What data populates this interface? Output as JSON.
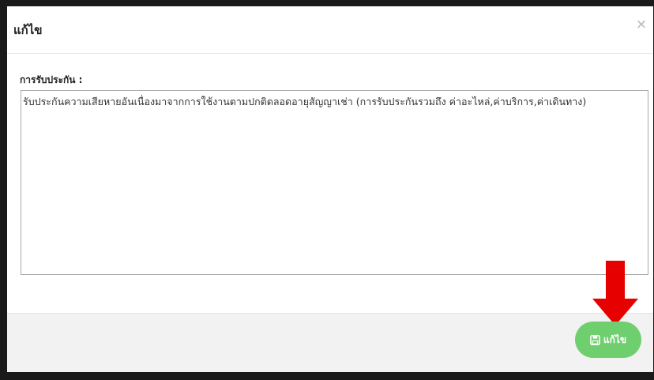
{
  "modal": {
    "title": "แก้ไข",
    "close_label": "×"
  },
  "form": {
    "warranty_label": "การรับประกัน :",
    "warranty_value": "รับประกันความเสียหายอันเนื่องมาจากการใช้งานตามปกติตลอดอายุสัญญาเช่า (การรับประกันรวมถึง ค่าอะไหล่,ค่าบริการ,ค่าเดินทาง)"
  },
  "footer": {
    "edit_button_label": "แก้ไข",
    "edit_button_icon": "save-icon",
    "edit_button_color": "#6fcf6f"
  },
  "annotation": {
    "arrow_color": "#e60000",
    "arrow_icon": "arrow-down-icon"
  }
}
